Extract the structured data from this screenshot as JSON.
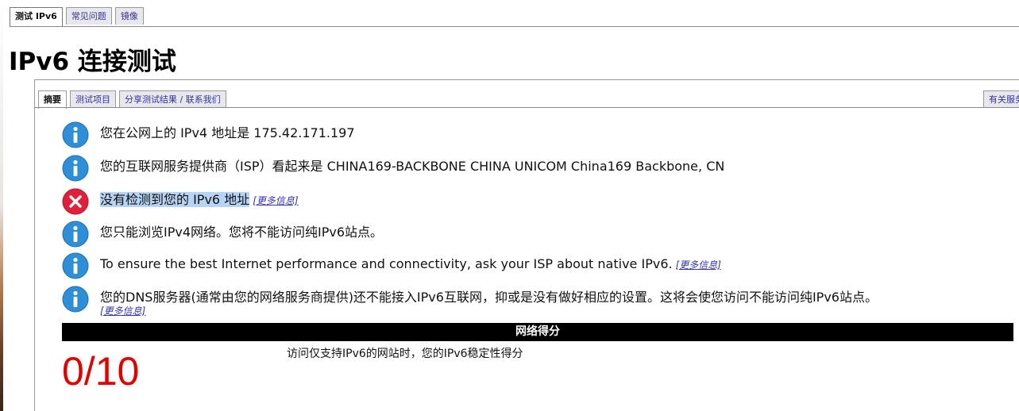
{
  "top_tabs": [
    "测试 IPv6",
    "常见问题",
    "镜像"
  ],
  "page_title": "IPv6 连接测试",
  "sub_tabs": [
    "摘要",
    "测试项目",
    "分享测试结果 / 联系我们"
  ],
  "sub_tab_right": "有关服务",
  "messages": [
    {
      "icon": "info",
      "text": "您在公网上的 IPv4 地址是 175.42.171.197"
    },
    {
      "icon": "info",
      "text": "您的互联网服务提供商（ISP）看起来是 CHINA169-BACKBONE CHINA UNICOM China169 Backbone, CN"
    },
    {
      "icon": "error",
      "text": "没有检测到您的 IPv6 地址",
      "more": "[更多信息]"
    },
    {
      "icon": "info",
      "text": "您只能浏览IPv4网络。您将不能访问纯IPv6站点。"
    },
    {
      "icon": "info",
      "text": "To ensure the best Internet performance and connectivity, ask your ISP about native IPv6.",
      "more": "[更多信息]"
    },
    {
      "icon": "info",
      "text": "您的DNS服务器(通常由您的网络服务商提供)还不能接入IPv6互联网，抑或是没有做好相应的设置。这将会使您访问不能访问纯IPv6站点。",
      "more": "[更多信息]"
    }
  ],
  "score": {
    "header": "网络得分",
    "value": "0/10",
    "description": "访问仅支持IPv6的网站时，您的IPv6稳定性得分"
  },
  "colors": {
    "info_icon": "#2e8fd8",
    "error_icon": "#e0203a",
    "score_value": "#e00000",
    "link": "#3333aa"
  }
}
